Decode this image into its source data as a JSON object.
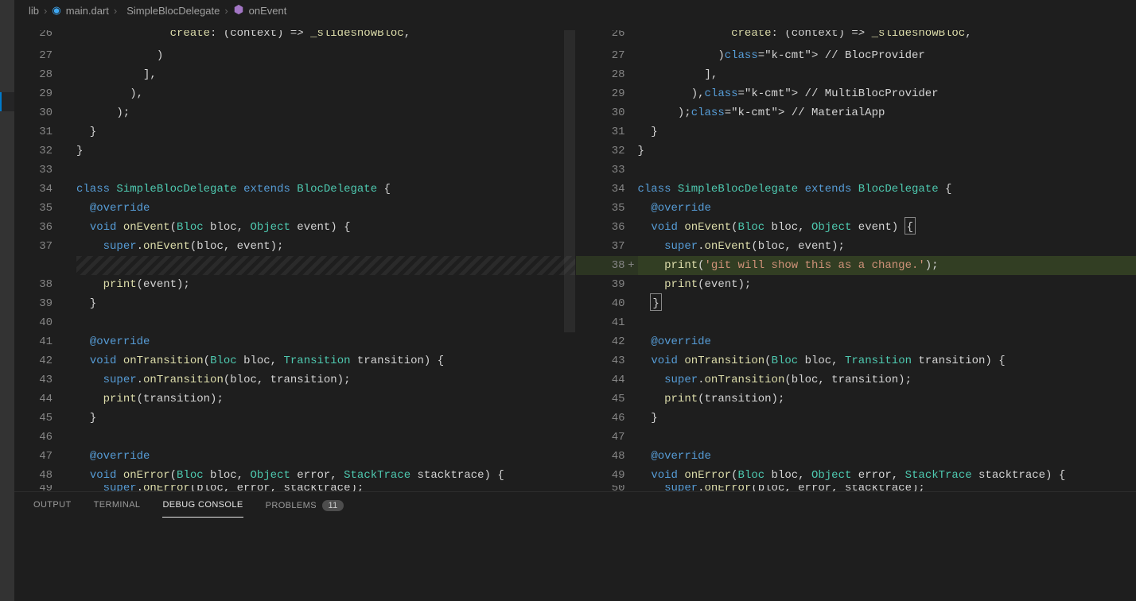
{
  "breadcrumb": {
    "folder": "lib",
    "file": "main.dart",
    "class": "SimpleBlocDelegate",
    "method": "onEvent"
  },
  "panel": {
    "output": "OUTPUT",
    "terminal": "TERMINAL",
    "debug": "DEBUG CONSOLE",
    "problems": "PROBLEMS",
    "problems_count": "11"
  },
  "left_lines": [
    {
      "n": "26",
      "c": "              create: (context) => _slideshowBloc,",
      "cut": 1
    },
    {
      "n": "27",
      "c": "            )"
    },
    {
      "n": "28",
      "c": "          ],"
    },
    {
      "n": "29",
      "c": "        ),"
    },
    {
      "n": "30",
      "c": "      );"
    },
    {
      "n": "31",
      "c": "  }"
    },
    {
      "n": "32",
      "c": "}"
    },
    {
      "n": "33",
      "c": ""
    },
    {
      "n": "34",
      "c": "class SimpleBlocDelegate extends BlocDelegate {",
      "kw": [
        "class",
        "extends"
      ],
      "type": [
        "SimpleBlocDelegate",
        "BlocDelegate"
      ]
    },
    {
      "n": "35",
      "c": "  @override"
    },
    {
      "n": "36",
      "c": "  void onEvent(Bloc bloc, Object event) {"
    },
    {
      "n": "37",
      "c": "    super.onEvent(bloc, event);"
    },
    {
      "n": "",
      "c": "",
      "hatch": 1
    },
    {
      "n": "38",
      "c": "    print(event);"
    },
    {
      "n": "39",
      "c": "  }"
    },
    {
      "n": "40",
      "c": ""
    },
    {
      "n": "41",
      "c": "  @override"
    },
    {
      "n": "42",
      "c": "  void onTransition(Bloc bloc, Transition transition) {"
    },
    {
      "n": "43",
      "c": "    super.onTransition(bloc, transition);"
    },
    {
      "n": "44",
      "c": "    print(transition);"
    },
    {
      "n": "45",
      "c": "  }"
    },
    {
      "n": "46",
      "c": ""
    },
    {
      "n": "47",
      "c": "  @override"
    },
    {
      "n": "48",
      "c": "  void onError(Bloc bloc, Object error, StackTrace stacktrace) {"
    },
    {
      "n": "49",
      "c": "    super.onError(bloc, error, stacktrace);",
      "cut": 1
    }
  ],
  "right_lines": [
    {
      "n": "26",
      "c": "              create: (context) => _slideshowBloc,",
      "cut": 1
    },
    {
      "n": "27",
      "c": "            ) // BlocProvider",
      "cmt": " // BlocProvider"
    },
    {
      "n": "28",
      "c": "          ],"
    },
    {
      "n": "29",
      "c": "        ), // MultiBlocProvider",
      "cmt": " // MultiBlocProvider"
    },
    {
      "n": "30",
      "c": "      ); // MaterialApp",
      "cmt": " // MaterialApp"
    },
    {
      "n": "31",
      "c": "  }"
    },
    {
      "n": "32",
      "c": "}"
    },
    {
      "n": "33",
      "c": ""
    },
    {
      "n": "34",
      "c": "class SimpleBlocDelegate extends BlocDelegate {"
    },
    {
      "n": "35",
      "c": "  @override"
    },
    {
      "n": "36",
      "c": "  void onEvent(Bloc bloc, Object event) {",
      "cursor": 1
    },
    {
      "n": "37",
      "c": "    super.onEvent(bloc, event);"
    },
    {
      "n": "38",
      "c": "    print('git will show this as a change.');",
      "insert": 1,
      "plus": 1
    },
    {
      "n": "39",
      "c": "    print(event);"
    },
    {
      "n": "40",
      "c": "  }",
      "cursor2": 1
    },
    {
      "n": "41",
      "c": ""
    },
    {
      "n": "42",
      "c": "  @override"
    },
    {
      "n": "43",
      "c": "  void onTransition(Bloc bloc, Transition transition) {"
    },
    {
      "n": "44",
      "c": "    super.onTransition(bloc, transition);"
    },
    {
      "n": "45",
      "c": "    print(transition);"
    },
    {
      "n": "46",
      "c": "  }"
    },
    {
      "n": "47",
      "c": ""
    },
    {
      "n": "48",
      "c": "  @override"
    },
    {
      "n": "49",
      "c": "  void onError(Bloc bloc, Object error, StackTrace stacktrace) {"
    },
    {
      "n": "50",
      "c": "    super.onError(bloc, error, stacktrace);",
      "cut": 1
    }
  ]
}
